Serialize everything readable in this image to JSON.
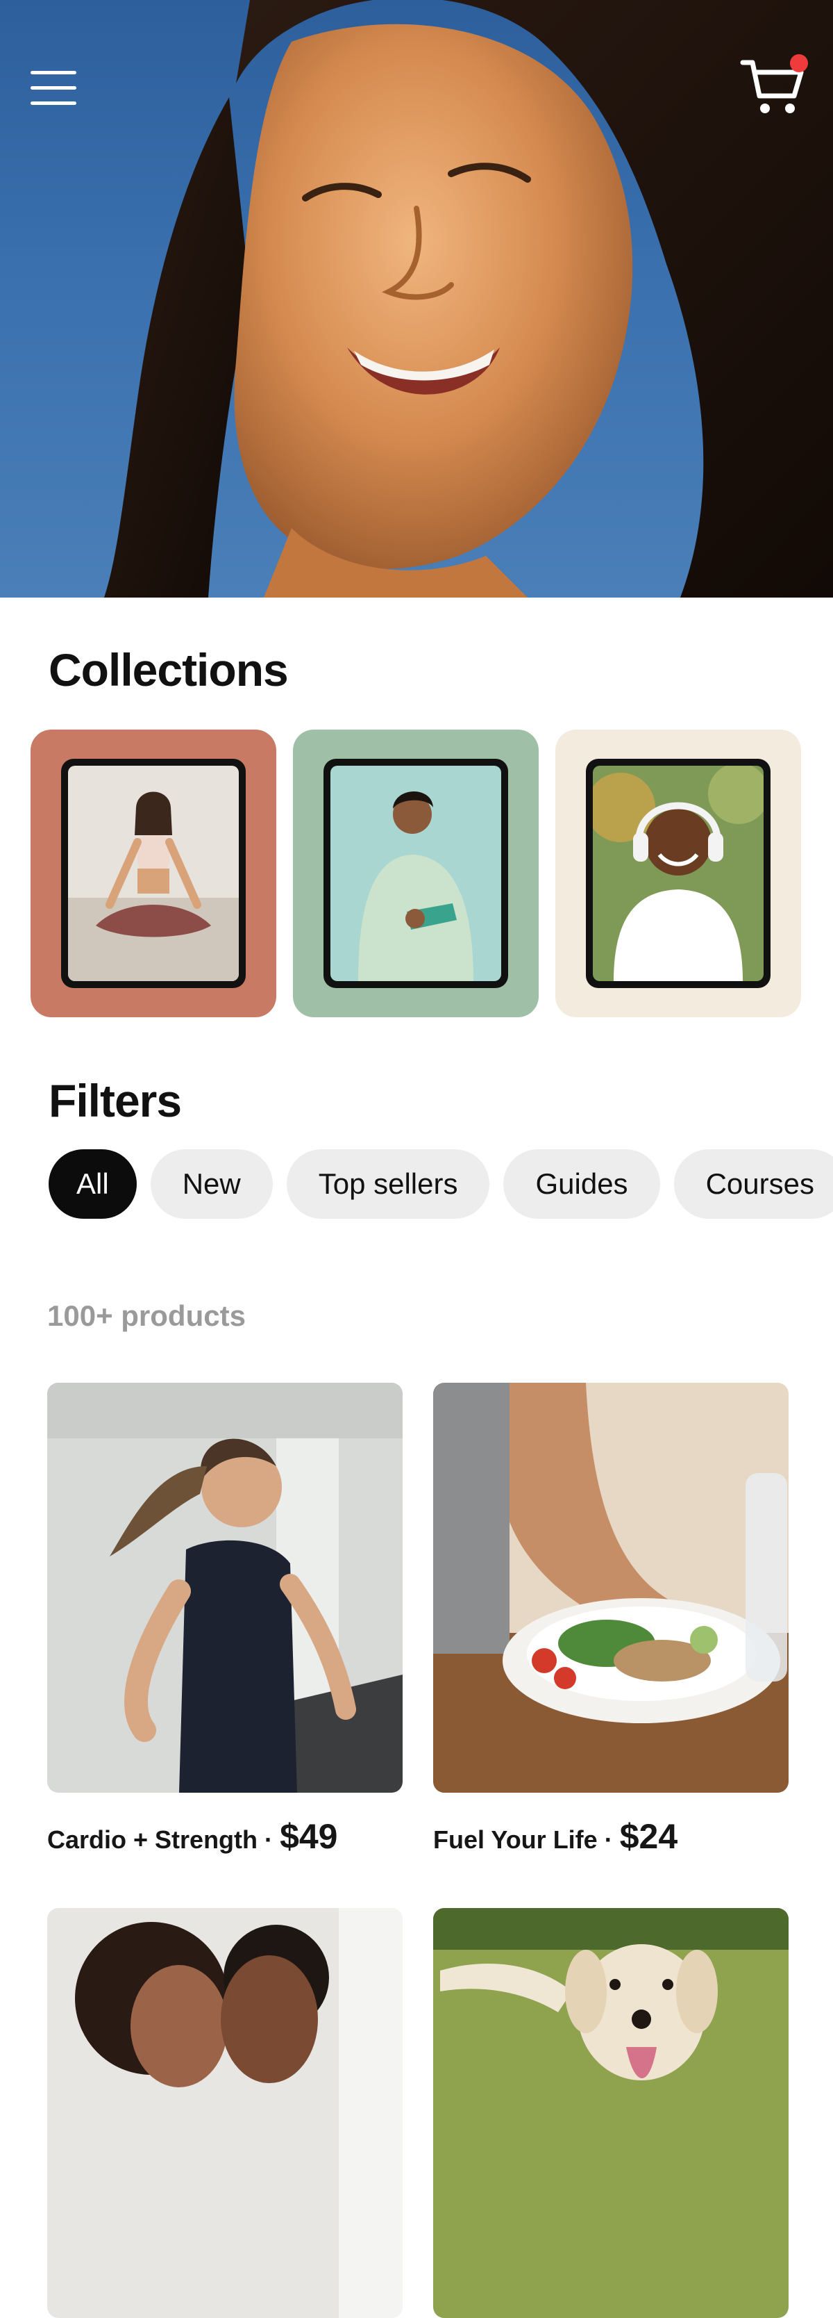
{
  "header": {
    "menu_icon": "hamburger-menu-icon",
    "cart_icon": "shopping-cart-icon",
    "cart_badge_color": "#ef3b3b"
  },
  "collections": {
    "title": "Collections",
    "items": [
      {
        "background": "#c97a64",
        "image": "woman-meditating-yoga-pose"
      },
      {
        "background": "#9fc0a6",
        "image": "woman-in-green-jacket-holding-phone"
      },
      {
        "background": "#f3ebdd",
        "image": "man-wearing-headphones-smiling"
      }
    ]
  },
  "filters": {
    "title": "Filters",
    "chips": [
      "All",
      "New",
      "Top sellers",
      "Guides",
      "Courses"
    ],
    "active_index": 0
  },
  "products": {
    "count_label": "100+ products",
    "items": [
      {
        "name": "Cardio + Strength",
        "separator": "·",
        "price": "$49",
        "image": "woman-running-on-treadmill"
      },
      {
        "name": "Fuel Your Life",
        "separator": "·",
        "price": "$24",
        "image": "plate-of-salad-and-grilled-chicken"
      },
      {
        "name": "",
        "separator": "",
        "price": "",
        "image": "couple-smiling-foreheads-together"
      },
      {
        "name": "",
        "separator": "",
        "price": "",
        "image": "golden-retriever-in-meadow"
      }
    ]
  }
}
